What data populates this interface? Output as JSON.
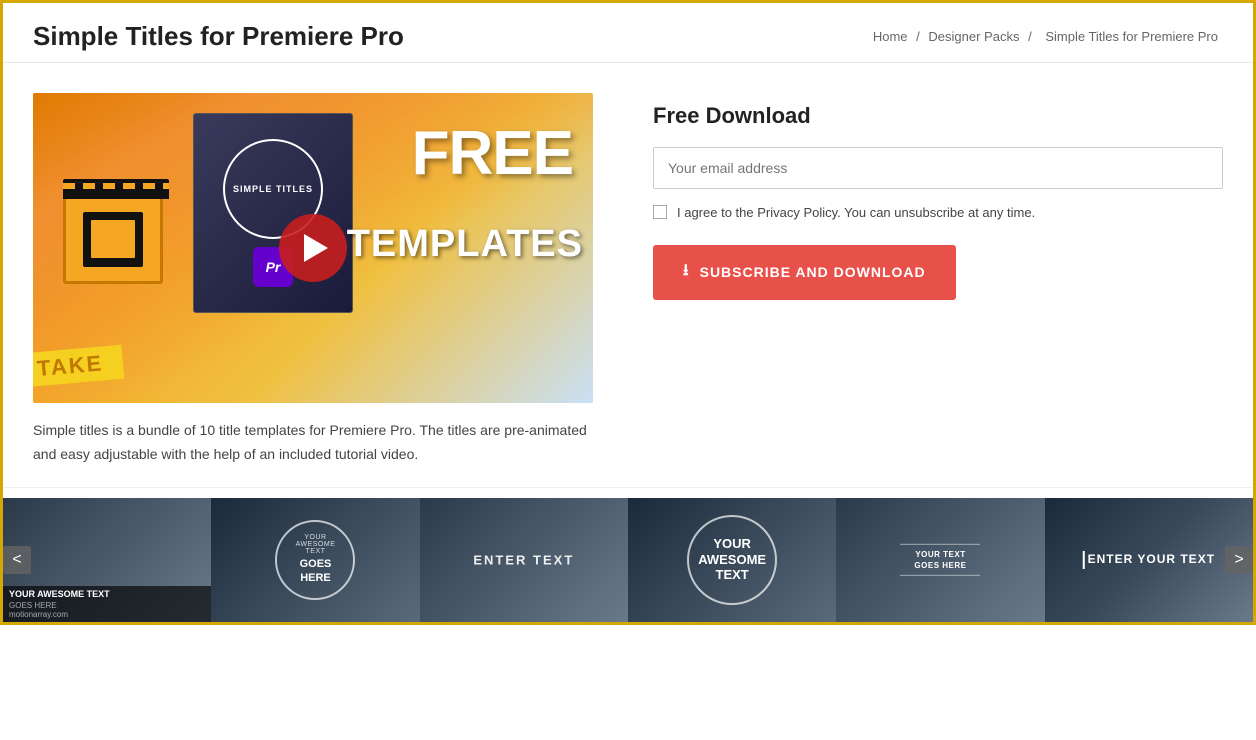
{
  "page": {
    "title": "Simple Titles for Premiere Pro"
  },
  "breadcrumb": {
    "home": "Home",
    "separator1": "/",
    "designer_packs": "Designer Packs",
    "separator2": "/",
    "current": "Simple Titles for Premiere Pro"
  },
  "free_download": {
    "title": "Free Download",
    "email_placeholder": "Your email address",
    "privacy_text": "I agree to the Privacy Policy. You can unsubscribe at any time.",
    "button_label": "SUBSCRIBE AND DOWNLOAD"
  },
  "description": "Simple titles is a bundle of 10 title templates for Premiere Pro. The titles are pre-animated and easy adjustable with the help of an included tutorial video.",
  "video": {
    "play_label": "Play"
  },
  "carousel": {
    "prev_label": "<",
    "next_label": ">",
    "thumbnails": [
      {
        "id": 1,
        "label_main": "YOUR AWESOME TEXT",
        "label_sub": "GOES HERE",
        "site": "motionarray.com"
      },
      {
        "id": 2,
        "label_main": "YOUR AWESOME TEXT",
        "label_sub": "GOES HERE"
      },
      {
        "id": 3,
        "label_main": "ENTER TEXT",
        "label_sub": ""
      },
      {
        "id": 4,
        "label_main": "YOUR AWESOME TEXT",
        "label_sub": ""
      },
      {
        "id": 5,
        "label_main": "YOUR TEXT",
        "label_sub": "GOES HERE"
      },
      {
        "id": 6,
        "label_main": "ENTER YOUR TEXT",
        "label_sub": ""
      }
    ]
  }
}
